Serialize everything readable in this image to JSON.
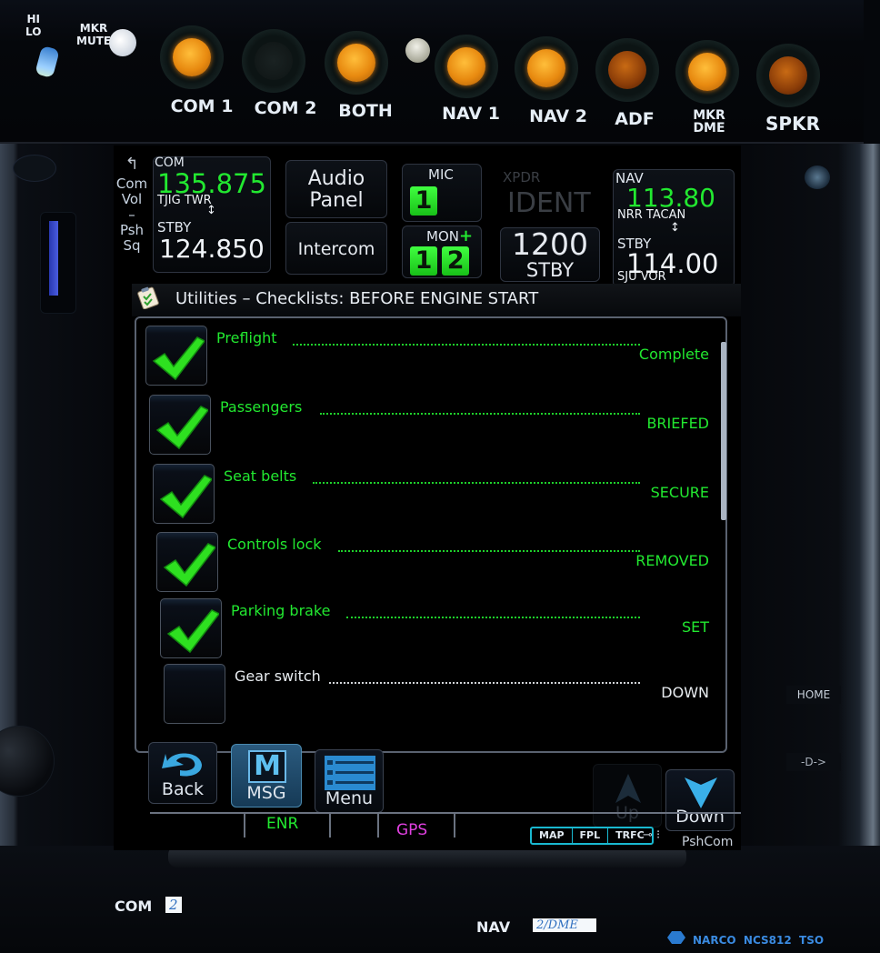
{
  "audio_panel": {
    "hi_lo_label_1": "HI",
    "hi_lo_label_2": "LO",
    "mkr_mute_label_1": "MKR",
    "mkr_mute_label_2": "MUTE",
    "buttons": [
      {
        "label": "COM 1",
        "state": "on"
      },
      {
        "label": "COM 2",
        "state": "off"
      },
      {
        "label": "BOTH",
        "state": "on"
      },
      {
        "label": "NAV 1",
        "state": "on"
      },
      {
        "label": "NAV 2",
        "state": "on"
      },
      {
        "label": "ADF",
        "state": "dim"
      },
      {
        "label_1": "MKR",
        "label_2": "DME",
        "state": "on"
      },
      {
        "label": "SPKR",
        "state": "dim"
      }
    ]
  },
  "knob_hint": {
    "line1": "Com",
    "line2": "Vol",
    "line3": "–",
    "line4": "Psh",
    "line5": "Sq"
  },
  "com": {
    "label": "COM",
    "active_freq": "135.875",
    "active_station": "TJIG TWR",
    "swap_icon": "↕",
    "stby_label": "STBY",
    "stby_freq": "124.850"
  },
  "audio_buttons": {
    "audio_panel_line1": "Audio",
    "audio_panel_line2": "Panel",
    "intercom": "Intercom"
  },
  "mic_mon": {
    "mic_label": "MIC",
    "mic_selected": "1",
    "mon_label": "MON",
    "mon_plus": "+",
    "mon_1": "1",
    "mon_2": "2"
  },
  "xpdr": {
    "label": "XPDR",
    "ident": "IDENT",
    "code": "1200",
    "mode": "STBY"
  },
  "nav": {
    "label": "NAV",
    "active_freq": "113.80",
    "active_station": "NRR TACAN",
    "swap_icon": "↕",
    "stby_label": "STBY",
    "stby_freq": "114.00",
    "stby_station": "SJU VOR"
  },
  "page": {
    "title": "Utilities – Checklists: BEFORE ENGINE START"
  },
  "checklist": {
    "items": [
      {
        "label": "Preflight",
        "value": "Complete",
        "checked": true
      },
      {
        "label": "Passengers",
        "value": "BRIEFED",
        "checked": true
      },
      {
        "label": "Seat belts",
        "value": "SECURE",
        "checked": true
      },
      {
        "label": "Controls lock",
        "value": "REMOVED",
        "checked": true
      },
      {
        "label": "Parking brake",
        "value": "SET",
        "checked": true
      },
      {
        "label": "Gear switch",
        "value": "DOWN",
        "checked": false
      }
    ]
  },
  "softkeys": {
    "back": "Back",
    "msg": "MSG",
    "msg_glyph": "M",
    "menu": "Menu",
    "up": "Up",
    "down": "Down"
  },
  "status_bar": {
    "mode": "ENR",
    "source": "GPS",
    "tabs": [
      "MAP",
      "FPL",
      "TRFC"
    ],
    "knob_hint": "PshCom"
  },
  "bezel": {
    "home": "HOME",
    "direct_to": "-D->"
  },
  "bottom": {
    "com_label": "COM",
    "com_tape": "2",
    "nav_label": "NAV",
    "nav_tape": "2/DME",
    "brand": "NARCO  NCS812  TSO"
  },
  "colors": {
    "active_green": "#22e830",
    "accent_cyan": "#19b8d0",
    "gps_magenta": "#e040e0",
    "lamp_amber": "#f0a020"
  }
}
